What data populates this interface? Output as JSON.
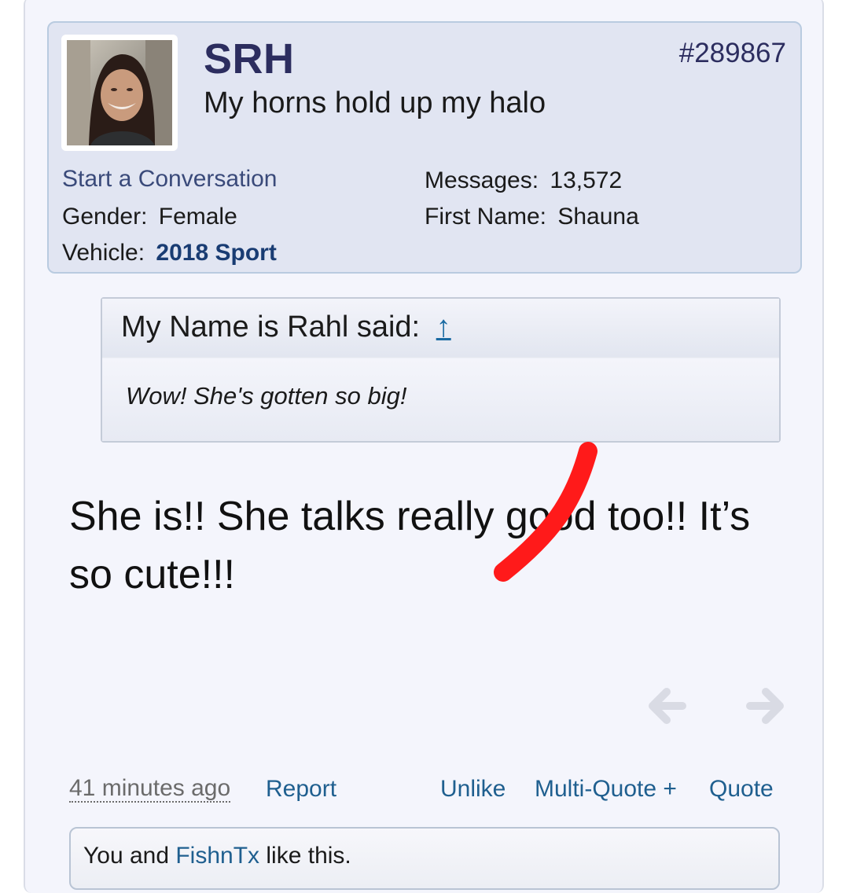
{
  "user": {
    "username": "SRH",
    "title": "My horns hold up my halo",
    "post_number": "#289867",
    "start_conversation": "Start a Conversation",
    "gender_label": "Gender:",
    "gender_value": "Female",
    "vehicle_label": "Vehicle:",
    "vehicle_value": "2018 Sport",
    "messages_label": "Messages:",
    "messages_value": "13,572",
    "first_name_label": "First Name:",
    "first_name_value": "Shauna"
  },
  "quote": {
    "author_said": "My Name is Rahl said:",
    "arrow": "↑",
    "text": "Wow! She's gotten so big!"
  },
  "message": {
    "line1": "She is!! She talks really good too!! It’s",
    "line2": "so cute!!!"
  },
  "footer": {
    "timestamp": "41 minutes ago",
    "report": "Report",
    "unlike": "Unlike",
    "multi_quote": "Multi-Quote +",
    "quote": "Quote"
  },
  "likes": {
    "prefix": "You and ",
    "user": "FishnTx",
    "suffix": " like this."
  },
  "icons": {
    "prev": "arrow-left-icon",
    "next": "arrow-right-icon"
  },
  "colors": {
    "username": "#2c2d5f",
    "link": "#1f5f8f",
    "annotation": "#ff1a1a"
  }
}
